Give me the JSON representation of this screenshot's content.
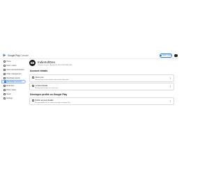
{
  "header": {
    "brand_name": "Google Play",
    "brand_suffix": "Console",
    "learn_button_label": "Learn more"
  },
  "sidebar": {
    "items": [
      {
        "label": "Home",
        "icon": "home-icon"
      },
      {
        "label": "Inbox / Alerts",
        "icon": "inbox-icon"
      },
      {
        "label": "Users and permissions",
        "icon": "users-icon"
      },
      {
        "label": "Order management",
        "icon": "orders-icon"
      },
      {
        "label": "Download reports",
        "icon": "download-icon"
      },
      {
        "label": "Developer account",
        "icon": "account-icon",
        "active": true
      },
      {
        "label": "Email lists",
        "icon": "email-icon"
      },
      {
        "label": "Policy status",
        "icon": "policy-icon"
      },
      {
        "label": "Setup",
        "icon": "setup-icon"
      },
      {
        "label": "Settings",
        "icon": "settings-icon"
      }
    ]
  },
  "account": {
    "name": "IndieSoftDev",
    "subtitle": "Personal account  ·  Account ID: 8576 5316 8408 5930"
  },
  "sections": {
    "account_details_title": "Account details",
    "profile_title": "Developer profile on Google Play"
  },
  "cards": {
    "about_you": {
      "title": "About you",
      "desc": "Manage your account details and personal information"
    },
    "contact": {
      "title": "Contact details",
      "desc": "Manage how Google can contact you"
    },
    "public": {
      "title": "Public account details",
      "desc": "Manage details that are shown to people on Google Play"
    }
  },
  "colors": {
    "accent": "#1a73e8",
    "active_bg": "#e8f0fe",
    "border": "#dadce0"
  }
}
